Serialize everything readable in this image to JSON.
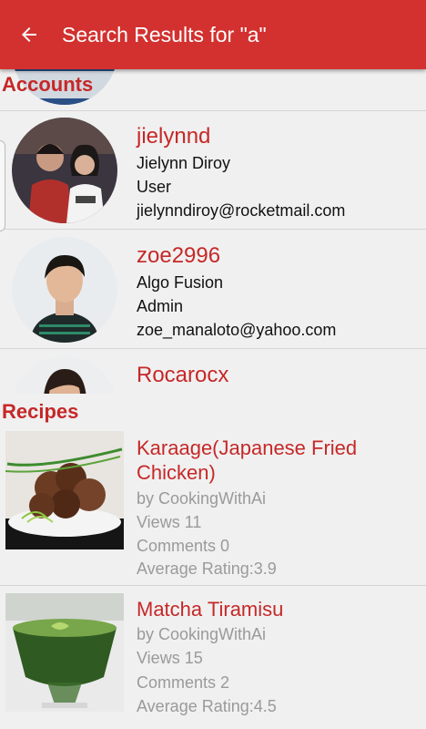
{
  "appbar": {
    "title": "Search Results for \"a\"",
    "back_icon": "arrow-back-icon",
    "color": "#d2312f"
  },
  "accounts": {
    "header": "Accounts",
    "items": [
      {
        "username": "jielynnd",
        "name": "Jielynn  Diroy",
        "role": "User",
        "email": "jielynndiroy@rocketmail.com"
      },
      {
        "username": "zoe2996",
        "name": "Algo Fusion",
        "role": "Admin",
        "email": "zoe_manaloto@yahoo.com"
      },
      {
        "username": "Rocarocx"
      }
    ]
  },
  "recipes": {
    "header": "Recipes",
    "items": [
      {
        "title": "Karaage(Japanese Fried Chicken)",
        "author": "by CookingWithAi",
        "views": "Views 11",
        "comments": "Comments 0",
        "rating": "Average Rating:3.9"
      },
      {
        "title": "Matcha Tiramisu",
        "author": "by CookingWithAi",
        "views": "Views 15",
        "comments": "Comments 2",
        "rating": "Average Rating:4.5"
      }
    ]
  }
}
